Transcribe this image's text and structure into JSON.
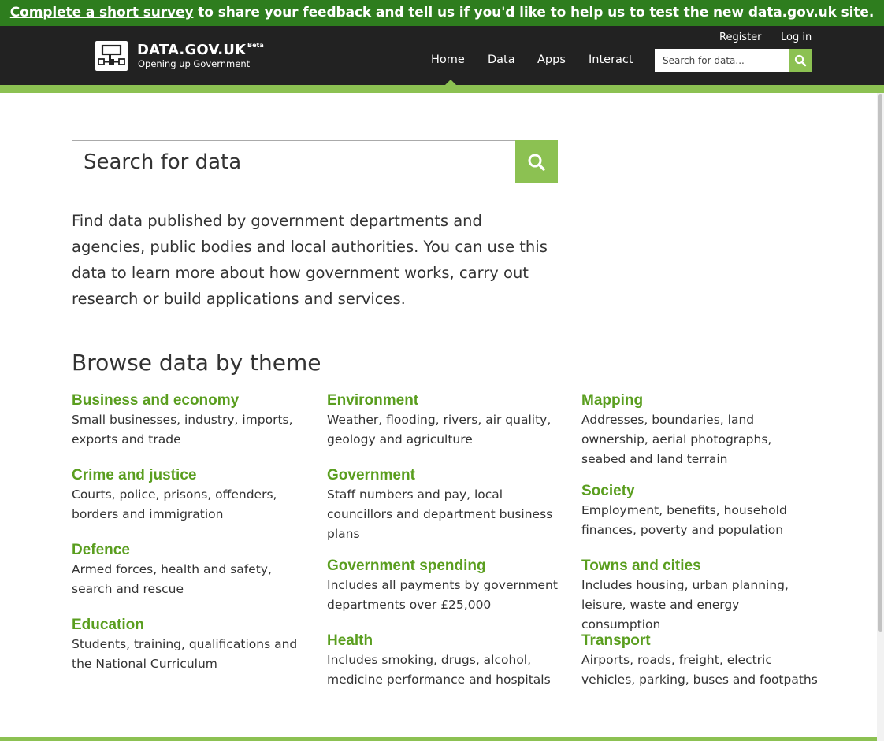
{
  "banner": {
    "link_text": "Complete a short survey",
    "rest_text": " to share your feedback and tell us if you'd like to help us to test the new data.gov.uk site."
  },
  "header": {
    "site_name": "DATA.GOV.UK",
    "beta": "Beta",
    "tagline": "Opening up Government",
    "register": "Register",
    "login": "Log in",
    "nav": [
      "Home",
      "Data",
      "Apps",
      "Interact"
    ],
    "active_nav": "Home",
    "search_placeholder": "Search for data...",
    "search_icon": "search-icon",
    "logo_icon": "network-diagram-icon"
  },
  "main": {
    "search_placeholder": "Search for data",
    "search_icon": "search-icon",
    "intro": "Find data published by government departments and agencies, public bodies and local authorities. You can use this data to learn more about how government works, carry out research or build applications and services.",
    "browse_heading": "Browse data by theme",
    "themes": [
      {
        "title": "Business and economy",
        "desc": "Small businesses, industry, imports, exports and trade"
      },
      {
        "title": "Crime and justice",
        "desc": "Courts, police, prisons, offenders, borders and immigration"
      },
      {
        "title": "Defence",
        "desc": "Armed forces, health and safety, search and rescue"
      },
      {
        "title": "Education",
        "desc": "Students, training, qualifications and the National Curriculum"
      },
      {
        "title": "Environment",
        "desc": "Weather, flooding, rivers, air quality, geology and agriculture"
      },
      {
        "title": "Government",
        "desc": "Staff numbers and pay, local councillors and department business plans"
      },
      {
        "title": "Government spending",
        "desc": "Includes all payments by government departments over £25,000"
      },
      {
        "title": "Health",
        "desc": "Includes smoking, drugs, alcohol, medicine performance and hospitals"
      },
      {
        "title": "Mapping",
        "desc": "Addresses, boundaries, land ownership, aerial photographs, seabed and land terrain"
      },
      {
        "title": "Society",
        "desc": "Employment, benefits, household finances, poverty and population"
      },
      {
        "title": "Towns and cities",
        "desc": "Includes housing, urban planning, leisure, waste and energy consumption"
      },
      {
        "title": "Transport",
        "desc": "Airports, roads, freight, electric vehicles, parking, buses and footpaths"
      }
    ]
  },
  "colors": {
    "banner_bg": "#2e7d1e",
    "header_bg": "#222222",
    "accent_green": "#8cc152",
    "theme_link": "#5a9e1f"
  }
}
